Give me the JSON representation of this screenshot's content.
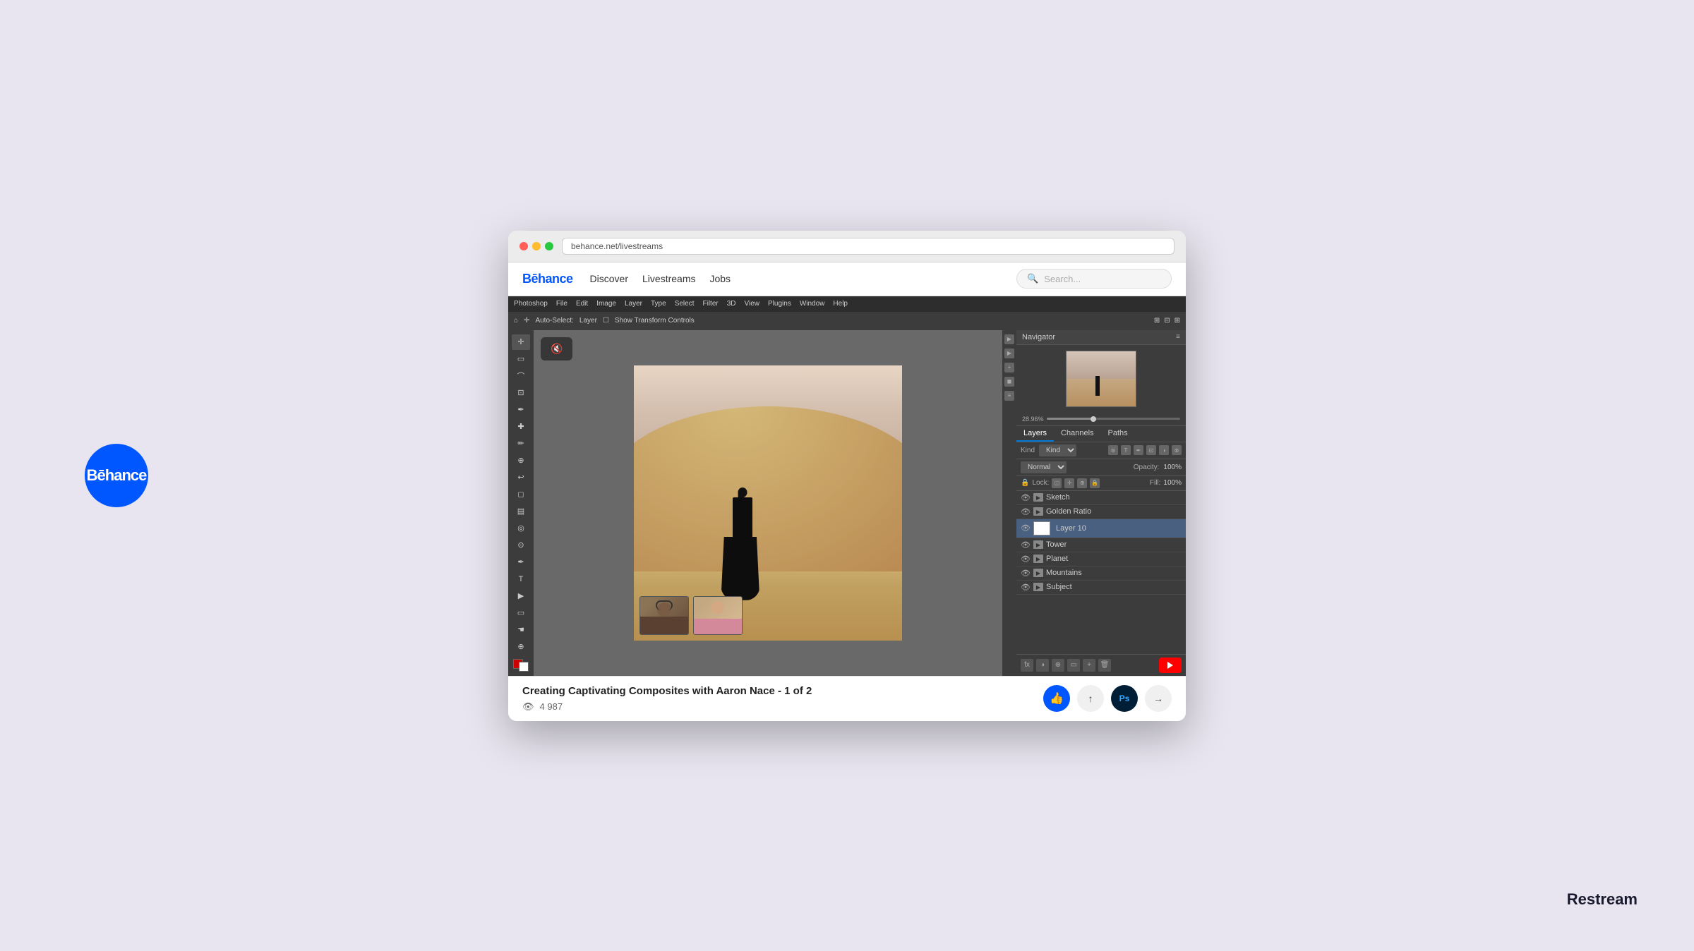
{
  "app": {
    "title": "Behance",
    "wordmark": "Bēhance"
  },
  "nav": {
    "links": [
      "Discover",
      "Livestreams",
      "Jobs"
    ],
    "search_placeholder": "Search..."
  },
  "photoshop": {
    "menu_items": [
      "Photoshop",
      "File",
      "Edit",
      "Image",
      "Layer",
      "Type",
      "Select",
      "Filter",
      "3D",
      "View",
      "Plugins",
      "Window",
      "Help"
    ],
    "options_bar": {
      "auto_select": "Auto-Select:",
      "layer": "Layer",
      "show_transform": "Show Transform Controls"
    },
    "navigator_title": "Navigator",
    "zoom_percent": "28.96%",
    "layers_tabs": [
      "Layers",
      "Channels",
      "Paths"
    ],
    "kind_label": "Kind",
    "blend_mode": "Normal",
    "opacity_label": "Opacity:",
    "opacity_value": "100%",
    "lock_label": "Lock:",
    "fill_label": "Fill:",
    "fill_value": "100%",
    "layers": [
      {
        "name": "Sketch",
        "type": "group",
        "visible": true
      },
      {
        "name": "Golden Ratio",
        "type": "group",
        "visible": true
      },
      {
        "name": "Layer 10",
        "type": "layer",
        "visible": true,
        "selected": true
      },
      {
        "name": "Tower",
        "type": "group",
        "visible": true
      },
      {
        "name": "Planet",
        "type": "group",
        "visible": true
      },
      {
        "name": "Mountains",
        "type": "group",
        "visible": true
      },
      {
        "name": "Subject",
        "type": "group",
        "visible": true
      }
    ]
  },
  "video": {
    "title": "Creating Captivating Composites with Aaron Nace - 1 of 2",
    "view_count": "4 987",
    "participants": [
      {
        "name": "Person 1 - woman with headphones"
      },
      {
        "name": "Person 2 - man in pink shirt"
      }
    ]
  },
  "mute_button": {
    "label": "Mute"
  },
  "restream_label": "Restream",
  "icons": {
    "like": "👍",
    "share": "↑",
    "ps": "Ps",
    "next": "→",
    "eye": "👁",
    "search": "🔍"
  }
}
